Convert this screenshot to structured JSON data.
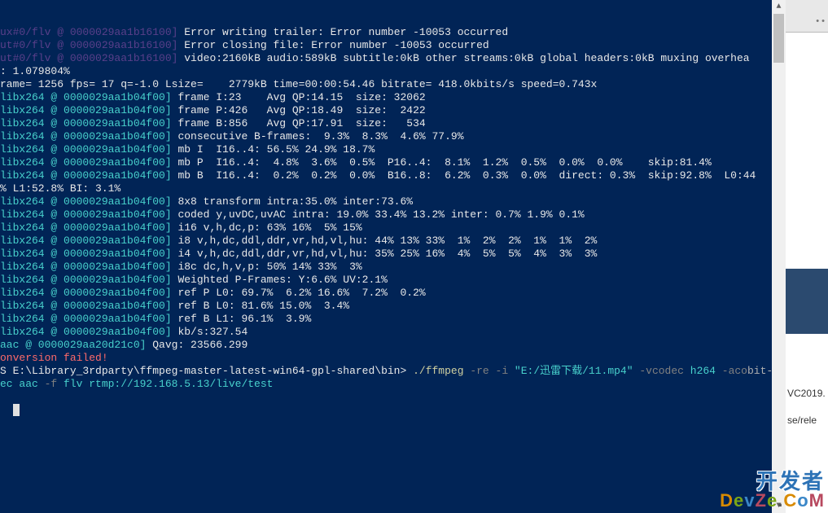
{
  "terminal": {
    "lines": [
      {
        "segs": [
          {
            "cls": "dim",
            "t": "ux#0/flv @ 0000029aa1b16100"
          },
          {
            "cls": "dim",
            "t": "] "
          },
          {
            "cls": "white",
            "t": "Error writing trailer: Error number -10053 occurred"
          }
        ]
      },
      {
        "segs": [
          {
            "cls": "dim",
            "t": "ut#0/flv @ 0000029aa1b16100"
          },
          {
            "cls": "dim",
            "t": "] "
          },
          {
            "cls": "white",
            "t": "Error closing file: Error number -10053 occurred"
          }
        ]
      },
      {
        "segs": [
          {
            "cls": "dim",
            "t": "ut#0/flv @ 0000029aa1b16100"
          },
          {
            "cls": "dim",
            "t": "] "
          },
          {
            "cls": "white",
            "t": "video:2160kB audio:589kB subtitle:0kB other streams:0kB global headers:0kB muxing overhea"
          }
        ]
      },
      {
        "segs": [
          {
            "cls": "white",
            "t": ": 1.079804%"
          }
        ]
      },
      {
        "segs": [
          {
            "cls": "white",
            "t": "rame= 1256 fps= 17 q=-1.0 Lsize=    2779kB time=00:00:54.46 bitrate= 418.0kbits/s speed=0.743x"
          }
        ]
      },
      {
        "segs": [
          {
            "cls": "cyan",
            "t": "libx264 @ 0000029aa1b04f00] "
          },
          {
            "cls": "white",
            "t": "frame I:23    Avg QP:14.15  size: 32062"
          }
        ]
      },
      {
        "segs": [
          {
            "cls": "cyan",
            "t": "libx264 @ 0000029aa1b04f00] "
          },
          {
            "cls": "white",
            "t": "frame P:426   Avg QP:18.49  size:  2422"
          }
        ]
      },
      {
        "segs": [
          {
            "cls": "cyan",
            "t": "libx264 @ 0000029aa1b04f00] "
          },
          {
            "cls": "white",
            "t": "frame B:856   Avg QP:17.91  size:   534"
          }
        ]
      },
      {
        "segs": [
          {
            "cls": "cyan",
            "t": "libx264 @ 0000029aa1b04f00] "
          },
          {
            "cls": "white",
            "t": "consecutive B-frames:  9.3%  8.3%  4.6% 77.9%"
          }
        ]
      },
      {
        "segs": [
          {
            "cls": "cyan",
            "t": "libx264 @ 0000029aa1b04f00] "
          },
          {
            "cls": "white",
            "t": "mb I  I16..4: 56.5% 24.9% 18.7%"
          }
        ]
      },
      {
        "segs": [
          {
            "cls": "cyan",
            "t": "libx264 @ 0000029aa1b04f00] "
          },
          {
            "cls": "white",
            "t": "mb P  I16..4:  4.8%  3.6%  0.5%  P16..4:  8.1%  1.2%  0.5%  0.0%  0.0%    skip:81.4%"
          }
        ]
      },
      {
        "segs": [
          {
            "cls": "cyan",
            "t": "libx264 @ 0000029aa1b04f00] "
          },
          {
            "cls": "white",
            "t": "mb B  I16..4:  0.2%  0.2%  0.0%  B16..8:  6.2%  0.3%  0.0%  direct: 0.3%  skip:92.8%  L0:44"
          }
        ]
      },
      {
        "segs": [
          {
            "cls": "white",
            "t": "% L1:52.8% BI: 3.1%"
          }
        ]
      },
      {
        "segs": [
          {
            "cls": "cyan",
            "t": "libx264 @ 0000029aa1b04f00] "
          },
          {
            "cls": "white",
            "t": "8x8 transform intra:35.0% inter:73.6%"
          }
        ]
      },
      {
        "segs": [
          {
            "cls": "cyan",
            "t": "libx264 @ 0000029aa1b04f00] "
          },
          {
            "cls": "white",
            "t": "coded y,uvDC,uvAC intra: 19.0% 33.4% 13.2% inter: 0.7% 1.9% 0.1%"
          }
        ]
      },
      {
        "segs": [
          {
            "cls": "cyan",
            "t": "libx264 @ 0000029aa1b04f00] "
          },
          {
            "cls": "white",
            "t": "i16 v,h,dc,p: 63% 16%  5% 15%"
          }
        ]
      },
      {
        "segs": [
          {
            "cls": "cyan",
            "t": "libx264 @ 0000029aa1b04f00] "
          },
          {
            "cls": "white",
            "t": "i8 v,h,dc,ddl,ddr,vr,hd,vl,hu: 44% 13% 33%  1%  2%  2%  1%  1%  2%"
          }
        ]
      },
      {
        "segs": [
          {
            "cls": "cyan",
            "t": "libx264 @ 0000029aa1b04f00] "
          },
          {
            "cls": "white",
            "t": "i4 v,h,dc,ddl,ddr,vr,hd,vl,hu: 35% 25% 16%  4%  5%  5%  4%  3%  3%"
          }
        ]
      },
      {
        "segs": [
          {
            "cls": "cyan",
            "t": "libx264 @ 0000029aa1b04f00] "
          },
          {
            "cls": "white",
            "t": "i8c dc,h,v,p: 50% 14% 33%  3%"
          }
        ]
      },
      {
        "segs": [
          {
            "cls": "cyan",
            "t": "libx264 @ 0000029aa1b04f00] "
          },
          {
            "cls": "white",
            "t": "Weighted P-Frames: Y:6.6% UV:2.1%"
          }
        ]
      },
      {
        "segs": [
          {
            "cls": "cyan",
            "t": "libx264 @ 0000029aa1b04f00] "
          },
          {
            "cls": "white",
            "t": "ref P L0: 69.7%  6.2% 16.6%  7.2%  0.2%"
          }
        ]
      },
      {
        "segs": [
          {
            "cls": "cyan",
            "t": "libx264 @ 0000029aa1b04f00] "
          },
          {
            "cls": "white",
            "t": "ref B L0: 81.6% 15.0%  3.4%"
          }
        ]
      },
      {
        "segs": [
          {
            "cls": "cyan",
            "t": "libx264 @ 0000029aa1b04f00] "
          },
          {
            "cls": "white",
            "t": "ref B L1: 96.1%  3.9%"
          }
        ]
      },
      {
        "segs": [
          {
            "cls": "cyan",
            "t": "libx264 @ 0000029aa1b04f00] "
          },
          {
            "cls": "white",
            "t": "kb/s:327.54"
          }
        ]
      },
      {
        "segs": [
          {
            "cls": "cyan",
            "t": "aac @ 0000029aa20d21c0] "
          },
          {
            "cls": "white",
            "t": "Qavg: 23566.299"
          }
        ]
      },
      {
        "segs": [
          {
            "cls": "red",
            "t": "onversion failed!"
          }
        ]
      },
      {
        "segs": [
          {
            "cls": "white",
            "t": "S E:\\Library_3rdparty\\ffmpeg-master-latest-win64-gpl-shared\\bin> "
          },
          {
            "cls": "yell",
            "t": "./ffmpeg "
          },
          {
            "cls": "dkgry",
            "t": "-re -i "
          },
          {
            "cls": "cyan",
            "t": "\"E:/迅雷下载/11.mp4\" "
          },
          {
            "cls": "dkgry",
            "t": "-vcodec "
          },
          {
            "cls": "cyan",
            "t": "h264 "
          },
          {
            "cls": "dkgry",
            "t": "-aco"
          },
          {
            "cls": "gray",
            "t": "bit-"
          }
        ]
      },
      {
        "segs": [
          {
            "cls": "cyan",
            "t": "ec aac "
          },
          {
            "cls": "dkgry",
            "t": "-f "
          },
          {
            "cls": "cyan",
            "t": "flv rtmp://192.168.5.13/live/test"
          }
        ]
      }
    ]
  },
  "scrollbar": {
    "up_glyph": "▲",
    "down_glyph": "▼"
  },
  "rightpane": {
    "dots": "• •",
    "txt1": "VC2019.",
    "txt2": "se/rele"
  },
  "watermark": {
    "cn": "开发者",
    "en": [
      "D",
      "e",
      "v",
      "Z",
      "e",
      ".",
      "C",
      "o",
      "M"
    ]
  }
}
